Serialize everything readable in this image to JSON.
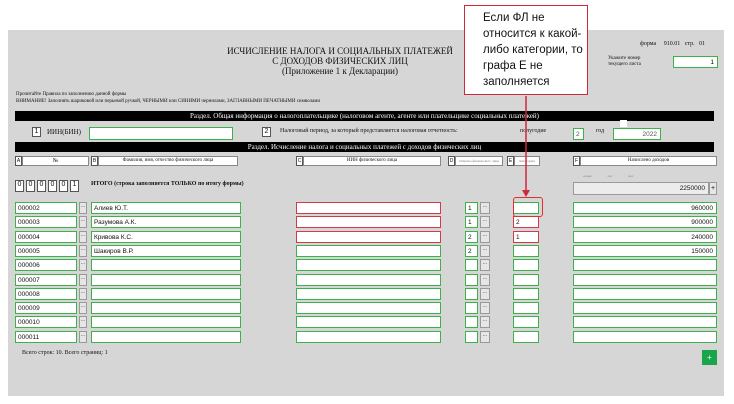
{
  "header": {
    "title_line1": "ИСЧИСЛЕНИЕ НАЛОГА И СОЦИАЛЬНЫХ ПЛАТЕЖЕЙ",
    "title_line2": "С ДОХОДОВ ФИЗИЧЕСКИХ ЛИЦ",
    "title_line3": "(Приложение 1 к Декларации)",
    "form_label": "форма",
    "form_no": "910.01",
    "page_label": "стр.",
    "page_no": "01",
    "current_sheet_label_1": "Укажите номер",
    "current_sheet_label_2": "текущего листа",
    "current_sheet_value": "1"
  },
  "notes": {
    "line1": "Прочитайте Правила по заполнению данной формы",
    "line2": "ВНИМАНИЕ! Заполнять шариковой или перьевой ручкой, ЧЕРНЫМИ или СИНИМИ чернилами, ЗАГЛАВНЫМИ ПЕЧАТНЫМИ символами"
  },
  "section1": {
    "title": "Раздел. Общая информация о налогоплательщике (налоговом агенте, агенте или плательщике социальных платежей)",
    "field1_no": "1",
    "iin_label": "ИИН(БИН)",
    "iin_value": "",
    "field2_no": "2",
    "period_label": "Налоговый период, за который представляется налоговая отчетность:",
    "halfyear_label": "полугодие",
    "halfyear_value": "2",
    "year_label": "год",
    "year_value": "2022"
  },
  "section2": {
    "title": "Раздел. Исчисление налога и социальных платежей с доходов физических лиц",
    "columns": {
      "A": {
        "letter": "A",
        "label": "№"
      },
      "B": {
        "letter": "B",
        "label": "Фамилия, имя, отчество физического лица"
      },
      "C": {
        "letter": "C",
        "label": "ИИН физического лица"
      },
      "D": {
        "letter": "D",
        "label": "Отметка физического лица"
      },
      "E": {
        "letter": "E",
        "label": "Категория"
      },
      "F": {
        "letter": "F",
        "label": "Начислено доходов"
      }
    },
    "f_sub_headers": [
      "номер",
      "кол",
      "мес"
    ],
    "total_digits": [
      "0",
      "0",
      "0",
      "0",
      "0",
      "1"
    ],
    "total_label": "ИТОГО (строка заполняется ТОЛЬКО по итогу формы)",
    "total_value": "2250000",
    "rows": [
      {
        "no": "000002",
        "name": "Алиев Ю.Т.",
        "iin": "",
        "d": "1",
        "e": "",
        "income": "960000"
      },
      {
        "no": "000003",
        "name": "Разумова А.К.",
        "iin": "",
        "d": "1",
        "e": "2",
        "income": "900000"
      },
      {
        "no": "000004",
        "name": "Кривова К.С.",
        "iin": "",
        "d": "2",
        "e": "1",
        "income": "240000"
      },
      {
        "no": "000005",
        "name": "Шакиров В.Р.",
        "iin": "",
        "d": "2",
        "e": "",
        "income": "150000"
      },
      {
        "no": "000006",
        "name": "",
        "iin": "",
        "d": "",
        "e": "",
        "income": ""
      },
      {
        "no": "000007",
        "name": "",
        "iin": "",
        "d": "",
        "e": "",
        "income": ""
      },
      {
        "no": "000008",
        "name": "",
        "iin": "",
        "d": "",
        "e": "",
        "income": ""
      },
      {
        "no": "000009",
        "name": "",
        "iin": "",
        "d": "",
        "e": "",
        "income": ""
      },
      {
        "no": "000010",
        "name": "",
        "iin": "",
        "d": "",
        "e": "",
        "income": ""
      },
      {
        "no": "000011",
        "name": "",
        "iin": "",
        "d": "",
        "e": "",
        "income": ""
      }
    ],
    "row_button": "...",
    "summary": "Всего строк: 10. Всего страниц: 1",
    "add_button": "+"
  },
  "callout": {
    "text": "Если ФЛ не относится к какой-либо категории, то графа Е не заполняется"
  },
  "colors": {
    "form_bg": "#d6d6d6",
    "field_border": "#3cb34a",
    "error_border": "#d23a4a",
    "callout_border": "#d0273a",
    "add_button": "#19a64a"
  }
}
